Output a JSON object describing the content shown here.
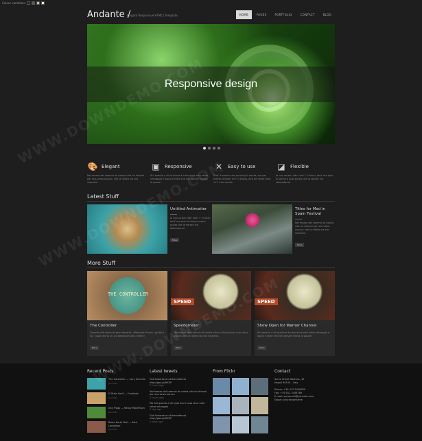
{
  "topbar": {
    "color_variations_label": "Colour variations"
  },
  "colors": {
    "swatches": [
      "#1e1e1e",
      "#5a5a5a",
      "#c8c18f",
      "#e3e3e3"
    ]
  },
  "header": {
    "logo": "Andante /",
    "tagline": "Elegant Responsive HTML5 Template",
    "nav": [
      "HOME",
      "PAGES",
      "PORTFOLIO",
      "CONTACT",
      "BLOG"
    ],
    "active_nav": "HOME"
  },
  "slider": {
    "caption": "Responsive design",
    "slide_count": 4,
    "active_slide": 1
  },
  "features": [
    {
      "icon": "palette-icon",
      "glyph": "🎨",
      "title": "Elegant",
      "text": "Nel mezzo del cammin di nostra vita mi ritrovai per una selva oscura, che la diritta via era smarrita."
    },
    {
      "icon": "devices-icon",
      "glyph": "▣",
      "title": "Responsive",
      "text": "Ahi quanto a dir qual era è cosa dura esta selva selvaggia e aspra e forte che nel pensier rinova la paura!"
    },
    {
      "icon": "tools-icon",
      "glyph": "✕",
      "title": "Easy to use",
      "text": "Tant' è amara che poco è più morte; ma per trattar del ben ch'i' vi trovai, dirò de l'altre cose ch'i' v'ho scorte."
    },
    {
      "icon": "paper-icon",
      "glyph": "◪",
      "title": "Flexible",
      "text": "Io non so ben ridir com' i' v'intrai, tant' era pien di sonno a quel punto che la verace via abbandonai."
    }
  ],
  "latest": {
    "title": "Latest Stuff",
    "posts": [
      {
        "title": "Untitled Antimatter",
        "text": "Io non so ben ridir com' i' v'intrai, tant' era pien di sonno a quel punto che la verace via abbandonai.",
        "more": "More"
      },
      {
        "title": "Titles for Mad in Spain Festival",
        "text": "Nel mezzo del cammin di nostra vita mi ritrovai per una selva oscura, che la diritta via era smarrita.",
        "more": "More"
      }
    ]
  },
  "more_stuff": {
    "title": "More Stuff",
    "cards": [
      {
        "title": "The Controller",
        "overlay": "THE CONTROLLER",
        "text": "Quando vidi esse nel gran deserto, «Miserere di me», gridai a lui, «qual che tu sii, od ombra od omo certo!»",
        "more": "More"
      },
      {
        "title": "Speedometer",
        "overlay": "SPEED",
        "text": "Nel mezzo del cammin di nostra vita mi ritrovai per una selva oscura, che la diritta via era smarrita.",
        "more": "More"
      },
      {
        "title": "Show Open for Warner Channel",
        "overlay": "SPEED",
        "text": "Ahi quanto a dir qual era è cosa dura esta selva selvaggia e aspra e forte che nel pensier rinova la paura!",
        "more": "More"
      }
    ]
  },
  "footer": {
    "recent_posts": {
      "title": "Recent Posts",
      "items": [
        {
          "title": "The Controller — Cory Schmitz",
          "date": "Jan 2012"
        },
        {
          "title": "El Mata Serif — Funkhole",
          "date": "Jan 2012"
        },
        {
          "title": "Any Frogs — Randy Robertson",
          "date": "Jan 2012"
        },
        {
          "title": "Boise North Doll — Seth Lamphear",
          "date": "Jan 2012"
        }
      ]
    },
    "latest_tweets": {
      "title": "Latest tweets",
      "items": [
        {
          "text": "Get Andante on #themeforest http://goo.gl/HXXP",
          "time": "2 hours ago"
        },
        {
          "text": "Nel mezzo del cammin di nostra vita mi ritrovai per una selva oscura",
          "time": "5 hours ago"
        },
        {
          "text": "Ma Ahi quanto a dir qual era è cosa dura esta selva selvaggia",
          "time": "1 day ago"
        },
        {
          "text": "Get Andante on #themeforest http://goo.gl/HXXP",
          "time": "2 days ago"
        }
      ]
    },
    "flickr": {
      "title": "From Flickr",
      "count": 9
    },
    "contact": {
      "title": "Contact",
      "lines": [
        "Some Street Address, 10",
        "Napoli 80100 - Italy",
        "",
        "Phone: +39 012 3456789",
        "Fax: +39 012 3456789",
        "E-mail: youremail@yoursite.com",
        "Skype: yourskypename"
      ]
    }
  },
  "watermark": "WWW.DOWNDEMO.COM"
}
